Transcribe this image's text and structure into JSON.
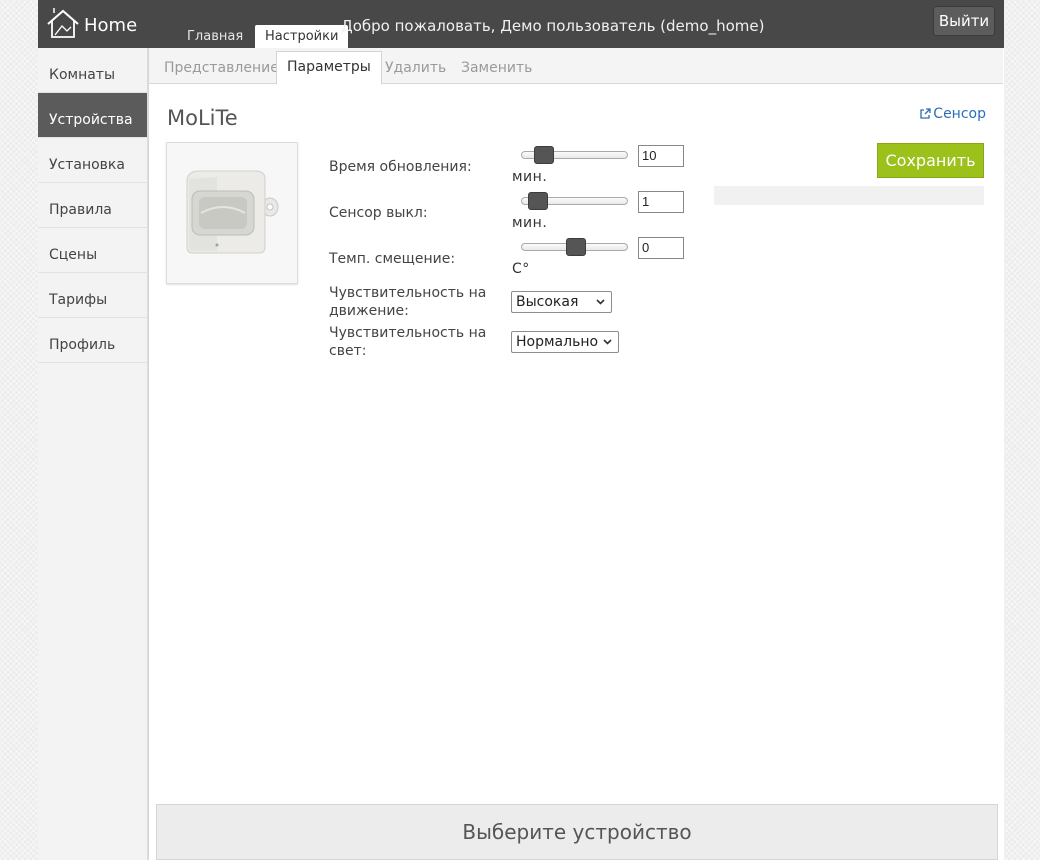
{
  "header": {
    "logo_text": "Home",
    "nav_tabs": [
      {
        "label": "Главная",
        "active": false
      },
      {
        "label": "Настройки",
        "active": true
      }
    ],
    "welcome_text": "Добро пожаловать, Демо пользователь (demo_home)",
    "logout_label": "Выйти"
  },
  "sidebar": {
    "items": [
      {
        "label": "Комнаты",
        "active": false
      },
      {
        "label": "Устройства",
        "active": true
      },
      {
        "label": "Установка",
        "active": false
      },
      {
        "label": "Правила",
        "active": false
      },
      {
        "label": "Сцены",
        "active": false
      },
      {
        "label": "Тарифы",
        "active": false
      },
      {
        "label": "Профиль",
        "active": false
      }
    ]
  },
  "subtabs": [
    {
      "label": "Представление",
      "active": false
    },
    {
      "label": "Параметры",
      "active": true
    },
    {
      "label": "Удалить",
      "active": false
    },
    {
      "label": "Заменить",
      "active": false
    }
  ],
  "device": {
    "title": "MoLiTe",
    "link_label": "Сенсор",
    "link_icon": "external-link-icon"
  },
  "params": {
    "update_time": {
      "label": "Время обновления:",
      "value": "10",
      "unit": "мин.",
      "slider_level": 0.14
    },
    "sensor_off": {
      "label": "Сенсор выкл:",
      "value": "1",
      "unit": "мин.",
      "slider_level": 0.07
    },
    "temp_offset": {
      "label": "Темп. смещение:",
      "value": "0",
      "unit": "C°",
      "slider_level": 0.52
    },
    "motion_sensitivity": {
      "label": "Чувствительность на движение:",
      "selected": "Высокая"
    },
    "light_sensitivity": {
      "label": "Чувствительность на свет:",
      "selected": "Нормально"
    }
  },
  "save_label": "Сохранить",
  "bottom_panel": {
    "text": "Выберите устройство"
  },
  "colors": {
    "topbar": "#484848",
    "sidebar_active": "#5b5b5b",
    "save_button": "#9cc11a",
    "link": "#2a6db8"
  }
}
